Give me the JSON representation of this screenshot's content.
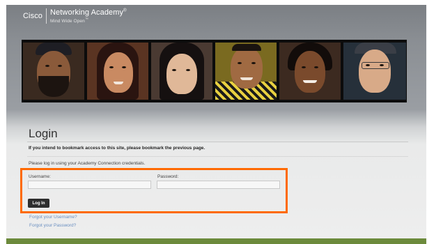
{
  "header": {
    "brand_name": "Cisco",
    "academy_name": "Networking Academy",
    "academy_mark": "®",
    "tagline": "Mind Wide Open",
    "tagline_mark": "™"
  },
  "login": {
    "title": "Login",
    "bookmark_notice": "If you intend to bookmark access to this site, please bookmark the previous page.",
    "instructions": "Please log in using your Academy Connection credentials.",
    "username_label": "Username:",
    "username_value": "",
    "password_label": "Password:",
    "password_value": "",
    "login_button": "Log In",
    "forgot_username": "Forgot your Username?",
    "forgot_password": "Forgot your Password?"
  },
  "colors": {
    "highlight": "#ff6a00",
    "link": "#6a8fc0",
    "button": "#2e2e2e",
    "footer_bar": "#6c8a3c"
  }
}
